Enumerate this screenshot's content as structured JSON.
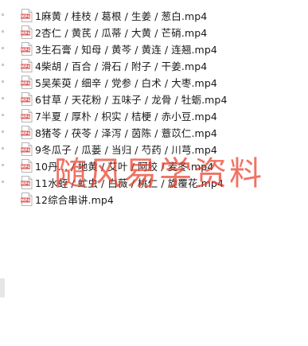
{
  "file_icon": {
    "icon": "mp4-file-icon",
    "badge": "MP4",
    "badge_color": "#d9534f"
  },
  "files": [
    {
      "name": "1麻黄 / 桂枝 / 葛根 / 生姜 / 葱白.mp4"
    },
    {
      "name": "2杏仁 / 黄芪 / 瓜蒂 / 大黄 / 芒硝.mp4"
    },
    {
      "name": "3生石膏 / 知母 / 黄芩 / 黄连 / 连翘.mp4"
    },
    {
      "name": "4柴胡 / 百合 / 滑石 / 附子 / 干姜.mp4"
    },
    {
      "name": "5吴茱萸 / 细辛 / 党参 / 白术 / 大枣.mp4"
    },
    {
      "name": "6甘草 / 天花粉 / 五味子 / 龙骨 / 牡蛎.mp4"
    },
    {
      "name": "7半夏 / 厚朴 / 枳实 / 桔梗 / 赤小豆.mp4"
    },
    {
      "name": "8猪苓 / 茯苓 / 泽泻 / 茵陈 / 薏苡仁.mp4"
    },
    {
      "name": "9冬瓜子 / 瓜蒌 / 当归 / 芍药 / 川芎.mp4"
    },
    {
      "name": "10丹… / 地黄 / 艾叶 / 阿胶 / 麦冬.mp4"
    },
    {
      "name": "11水蛭 / 虻虫 / 白薇 / 桃仁 / 旋覆花.mp4"
    },
    {
      "name": "12综合串讲.mp4"
    }
  ],
  "watermark": {
    "text": "随风易学资料",
    "color": "#eb3c28"
  }
}
